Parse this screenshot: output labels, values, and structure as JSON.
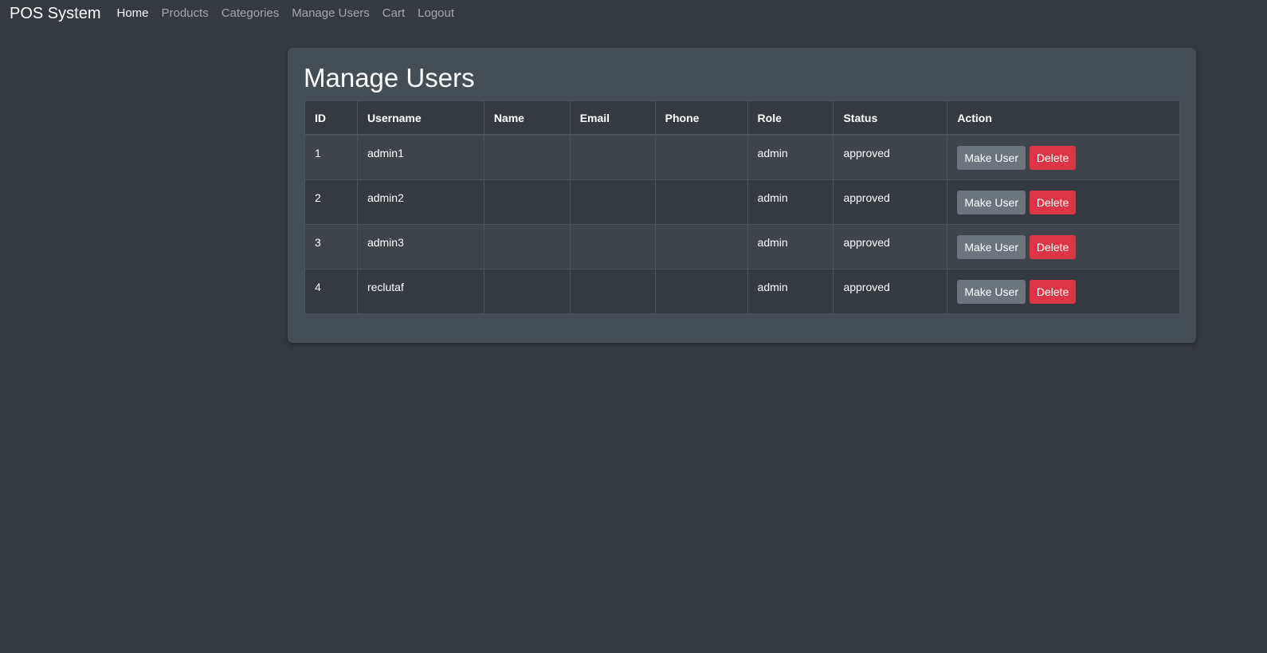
{
  "navbar": {
    "brand": "POS System",
    "links": [
      {
        "label": "Home",
        "active": true
      },
      {
        "label": "Products",
        "active": false
      },
      {
        "label": "Categories",
        "active": false
      },
      {
        "label": "Manage Users",
        "active": false
      },
      {
        "label": "Cart",
        "active": false
      },
      {
        "label": "Logout",
        "active": false
      }
    ]
  },
  "main": {
    "title": "Manage Users",
    "columns": [
      "ID",
      "Username",
      "Name",
      "Email",
      "Phone",
      "Role",
      "Status",
      "Action"
    ],
    "rows": [
      {
        "id": "1",
        "username": "admin1",
        "name": "",
        "email": "",
        "phone": "",
        "role": "admin",
        "status": "approved",
        "make_user_label": "Make User",
        "delete_label": "Delete"
      },
      {
        "id": "2",
        "username": "admin2",
        "name": "",
        "email": "",
        "phone": "",
        "role": "admin",
        "status": "approved",
        "make_user_label": "Make User",
        "delete_label": "Delete"
      },
      {
        "id": "3",
        "username": "admin3",
        "name": "",
        "email": "",
        "phone": "",
        "role": "admin",
        "status": "approved",
        "make_user_label": "Make User",
        "delete_label": "Delete"
      },
      {
        "id": "4",
        "username": "reclutaf",
        "name": "",
        "email": "",
        "phone": "",
        "role": "admin",
        "status": "approved",
        "make_user_label": "Make User",
        "delete_label": "Delete"
      }
    ]
  },
  "colors": {
    "background": "#343a40",
    "card": "#454d55",
    "secondary_button": "#6c757d",
    "danger_button": "#dc3545"
  }
}
